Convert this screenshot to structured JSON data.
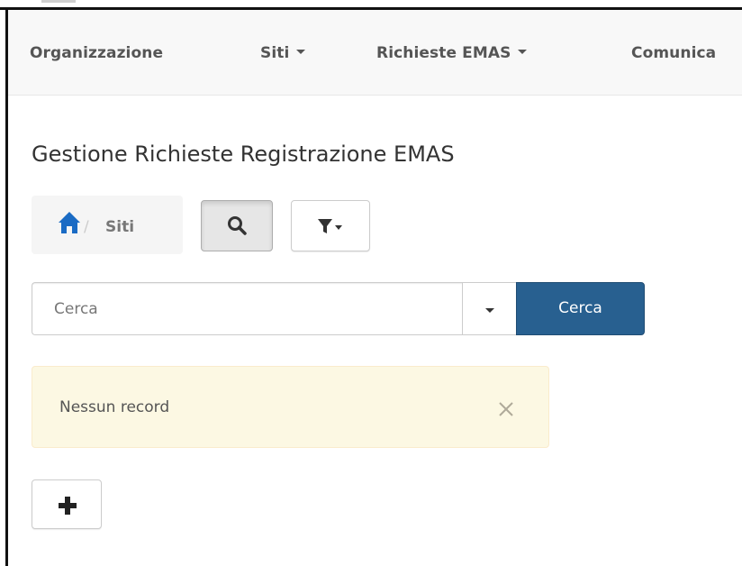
{
  "navbar": {
    "items": [
      {
        "label": "Organizzazione",
        "has_caret": false
      },
      {
        "label": "Siti",
        "has_caret": true
      },
      {
        "label": "Richieste EMAS",
        "has_caret": true
      },
      {
        "label": "Comunica",
        "has_caret": false
      }
    ]
  },
  "page": {
    "title": "Gestione Richieste Registrazione EMAS"
  },
  "breadcrumb": {
    "separator": "/",
    "current": "Siti",
    "home_icon": "home-icon"
  },
  "toolbar": {
    "search_icon": "search-icon",
    "filter_icon": "filter-icon"
  },
  "search": {
    "placeholder": "Cerca",
    "value": "",
    "button_label": "Cerca"
  },
  "alert": {
    "message": "Nessun record",
    "close_icon": "close-icon"
  },
  "actions": {
    "add_icon": "plus-icon"
  },
  "colors": {
    "primary": "#286090",
    "navbar_bg": "#f8f8f8",
    "alert_bg": "#fcf8e3",
    "home_icon": "#1a6bc4"
  }
}
